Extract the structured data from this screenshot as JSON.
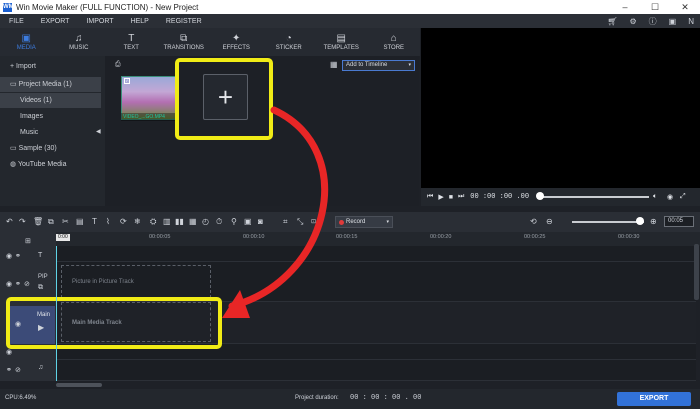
{
  "window": {
    "title": "Win Movie Maker (FULL FUNCTION) - New Project",
    "app_icon": "WM"
  },
  "menu": [
    "FILE",
    "EXPORT",
    "IMPORT",
    "HELP",
    "REGISTER"
  ],
  "menu_user_initial": "N",
  "tabs": [
    {
      "label": "MEDIA",
      "icon": "film-icon",
      "glyph": "▣"
    },
    {
      "label": "MUSIC",
      "icon": "music-icon",
      "glyph": "♫"
    },
    {
      "label": "TEXT",
      "icon": "text-icon",
      "glyph": "T"
    },
    {
      "label": "TRANSITIONS",
      "icon": "transitions-icon",
      "glyph": "⧉"
    },
    {
      "label": "EFFECTS",
      "icon": "effects-icon",
      "glyph": "✦"
    },
    {
      "label": "STICKER",
      "icon": "sticker-icon",
      "glyph": "◔"
    },
    {
      "label": "TEMPLATES",
      "icon": "templates-icon",
      "glyph": "▤"
    },
    {
      "label": "STORE",
      "icon": "store-icon",
      "glyph": "⌂"
    }
  ],
  "media_panel": {
    "import": "Import",
    "project_media": "Project Media (1)",
    "videos": "Videos (1)",
    "images": "Images",
    "music": "Music",
    "sample": "Sample (30)",
    "youtube": "YouTube Media"
  },
  "media_content": {
    "thumb_label": "VIDEO_...GO.MP4",
    "add_to_timeline": "Add to Timeline",
    "add_glyph": "+"
  },
  "preview": {
    "timecode": "00 :00 :00 .00"
  },
  "timeline": {
    "record_label": "Record",
    "zoom_value": "00:05",
    "ruler_start": "0:00",
    "ruler_ticks": [
      "00:00:05",
      "00:00:10",
      "00:00:15",
      "00:00:20",
      "00:00:25",
      "00:00:30"
    ],
    "tracks": {
      "pip_label": "PIP",
      "pip_placeholder": "Picture in Picture Track",
      "main_label": "Main",
      "main_placeholder": "Main Media Track"
    }
  },
  "status": {
    "cpu": "CPU:6.49%",
    "duration_label": "Project duration:",
    "duration_value": "00 : 00 : 00 . 00",
    "export": "EXPORT"
  },
  "colors": {
    "accent": "#3272d8",
    "highlight": "#f1ec16",
    "arrow": "#e82626"
  }
}
